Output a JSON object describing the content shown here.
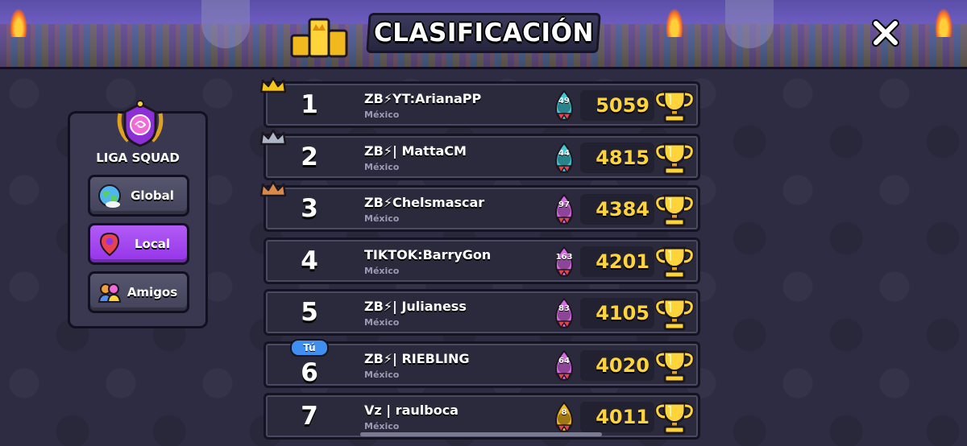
{
  "header": {
    "title": "CLASIFICACIÓN"
  },
  "league": {
    "name": "LIGA SQUAD"
  },
  "filters": [
    {
      "label": "Global",
      "icon": "globe-icon",
      "active": false
    },
    {
      "label": "Local",
      "icon": "location-pin-icon",
      "active": true
    },
    {
      "label": "Amigos",
      "icon": "friends-icon",
      "active": false
    }
  ],
  "you_label": "Tú",
  "leaderboard": [
    {
      "rank": "1",
      "name": "ZB⚡YT:ArianaPP",
      "country": "México",
      "level": "49",
      "score": "5059",
      "crown": "gold"
    },
    {
      "rank": "2",
      "name": "ZB⚡| MattaCM",
      "country": "México",
      "level": "44",
      "score": "4815",
      "crown": "silver"
    },
    {
      "rank": "3",
      "name": "ZB⚡Chelsmascar",
      "country": "México",
      "level": "97",
      "score": "4384",
      "crown": "bronze"
    },
    {
      "rank": "4",
      "name": "TIKTOK:BarryGon",
      "country": "México",
      "level": "163",
      "score": "4201",
      "crown": ""
    },
    {
      "rank": "5",
      "name": "ZB⚡| Julianess",
      "country": "México",
      "level": "83",
      "score": "4105",
      "crown": ""
    },
    {
      "rank": "6",
      "name": "ZB⚡| RIEBLING",
      "country": "México",
      "level": "64",
      "score": "4020",
      "crown": "",
      "is_you": true
    },
    {
      "rank": "7",
      "name": "Vz | raulboca",
      "country": "México",
      "level": "8",
      "score": "4011",
      "crown": ""
    }
  ],
  "colors": {
    "accent_purple": "#9b3eeb",
    "score_yellow": "#ffd43a",
    "gold": "#f5c518",
    "silver": "#aeb7c7",
    "bronze": "#d9894a",
    "you_blue": "#3f8ff0"
  }
}
